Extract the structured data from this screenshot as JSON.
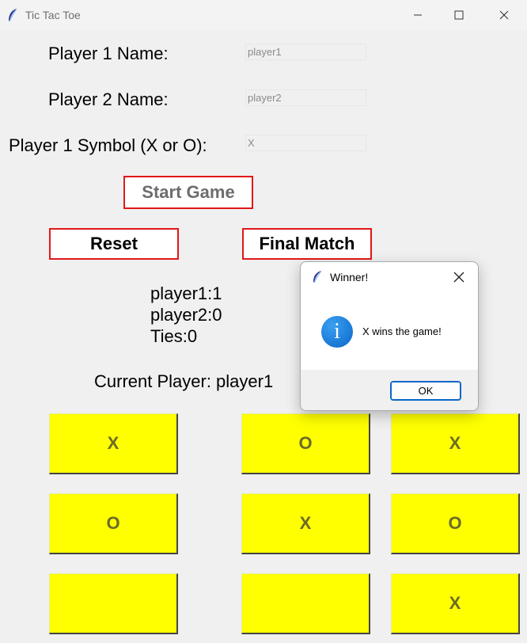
{
  "window": {
    "title": "Tic Tac Toe",
    "minimize_icon": "minimize-icon",
    "maximize_icon": "maximize-icon",
    "close_icon": "close-icon"
  },
  "form": {
    "player1_label": "Player 1 Name:",
    "player1_value": "player1",
    "player2_label": "Player 2 Name:",
    "player2_value": "player2",
    "symbol_label": "Player 1 Symbol (X or O):",
    "symbol_value": "X"
  },
  "buttons": {
    "start": "Start Game",
    "reset": "Reset",
    "final_match": "Final Match",
    "border_color": "#e01818"
  },
  "scores": {
    "player1": "player1:1",
    "player2": "player2:0",
    "ties": "Ties:0"
  },
  "status": {
    "current_player": "Current Player: player1"
  },
  "board": {
    "cells": [
      "X",
      "O",
      "X",
      "O",
      "X",
      "O",
      "",
      "",
      "X"
    ],
    "cell_color": "#ffff00"
  },
  "dialog": {
    "title": "Winner!",
    "message": "X wins the game!",
    "ok_label": "OK",
    "icon": "info-icon",
    "icon_glyph": "i"
  }
}
